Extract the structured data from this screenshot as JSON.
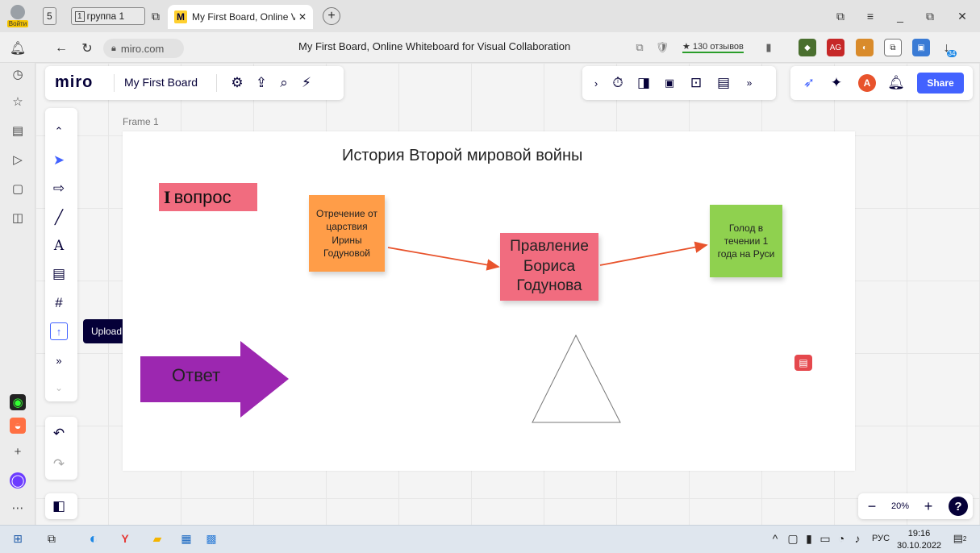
{
  "browser": {
    "profile_login": "Войти",
    "tab_group_count": "5",
    "group_tab_label": "группа 1",
    "active_tab_title": "My First Board, Online V",
    "new_tab": "+",
    "url": "miro.com",
    "page_title": "My First Board, Online Whiteboard for Visual Collaboration",
    "reviews": "★ 130 отзывов",
    "downloads_badge": "34",
    "extension_badge": "1",
    "window_controls": [
      "⧉",
      "≡",
      "_",
      "⧉",
      "✕"
    ]
  },
  "miro": {
    "logo": "miro",
    "board_name": "My First Board",
    "share_label": "Share",
    "avatar_initial": "A",
    "accent_color": "#4262ff",
    "zoom": "20%",
    "help": "?"
  },
  "toolbar": {
    "upload_tooltip": "Upload"
  },
  "board": {
    "frame_label": "Frame 1",
    "title": "История Второй мировой войны",
    "question_numeral": "I",
    "question_word": "вопрос",
    "sticky_1": "Отречение от царствия Ирины Годуновой",
    "sticky_2": "Правление Бориса Годунова",
    "sticky_3": "Голод в течении 1 года на Руси",
    "answer_label": "Ответ",
    "colors": {
      "orange_sticky": "#ff9d48",
      "pink_sticky": "#f16c7f",
      "green_sticky": "#8fd14f",
      "answer_arrow": "#9c27b0",
      "connector": "#e8532c"
    }
  },
  "taskbar": {
    "language": "РУС",
    "time": "19:16",
    "date": "30.10.2022",
    "notifications": "2"
  }
}
